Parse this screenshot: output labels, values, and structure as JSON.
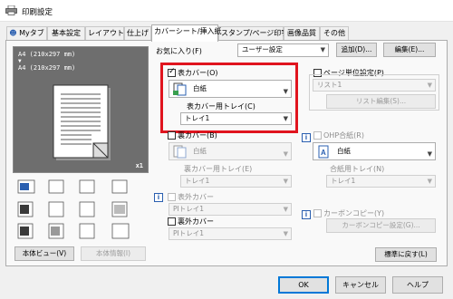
{
  "window": {
    "title": "印刷設定"
  },
  "tabs": [
    {
      "label": "Myタブ"
    },
    {
      "label": "基本設定"
    },
    {
      "label": "レイアウト"
    },
    {
      "label": "仕上げ"
    },
    {
      "label": "カバーシート/挿入紙"
    },
    {
      "label": "スタンプ/ページ印字"
    },
    {
      "label": "画像品質"
    },
    {
      "label": "その他"
    }
  ],
  "favorites": {
    "label": "お気に入り(F)",
    "value": "ユーザー設定",
    "add_label": "追加(D)...",
    "edit_label": "編集(E)..."
  },
  "preview": {
    "line1": "A4 (210x297 mm)",
    "arrow": "▼",
    "line2": "A4 (210x297 mm)",
    "copies": "x1"
  },
  "preview_buttons": {
    "printer_view": "本体ビュー(V)",
    "printer_info": "本体情報(I)"
  },
  "front_cover": {
    "checkbox_label": "表カバー(O)",
    "paper_value": "白紙",
    "tray_label": "表カバー用トレイ(C)",
    "tray_value": "トレイ1"
  },
  "back_cover": {
    "checkbox_label": "裏カバー(B)",
    "paper_value": "白紙",
    "tray_label": "裏カバー用トレイ(E)",
    "tray_value": "トレイ1"
  },
  "front_outer_cover": {
    "checkbox_label": "表外カバー",
    "tray_value": "PIトレイ1"
  },
  "back_outer_cover": {
    "checkbox_label": "裏外カバー",
    "tray_value": "PIトレイ1"
  },
  "per_page": {
    "checkbox_label": "ページ単位設定(P)",
    "list_value": "リスト1",
    "list_edit_label": "リスト編集(S)..."
  },
  "ohp": {
    "checkbox_label": "OHP合紙(R)",
    "paper_value": "白紙",
    "tray_label": "合紙用トレイ(N)",
    "tray_value": "トレイ1"
  },
  "carbon": {
    "checkbox_label": "カーボンコピー(Y)",
    "settings_label": "カーボンコピー設定(G)..."
  },
  "reset_label": "標準に戻す(L)",
  "footer": {
    "ok": "OK",
    "cancel": "キャンセル",
    "help": "ヘルプ"
  },
  "colors": {
    "highlight": "#e0141e",
    "accent": "#0078d7"
  }
}
